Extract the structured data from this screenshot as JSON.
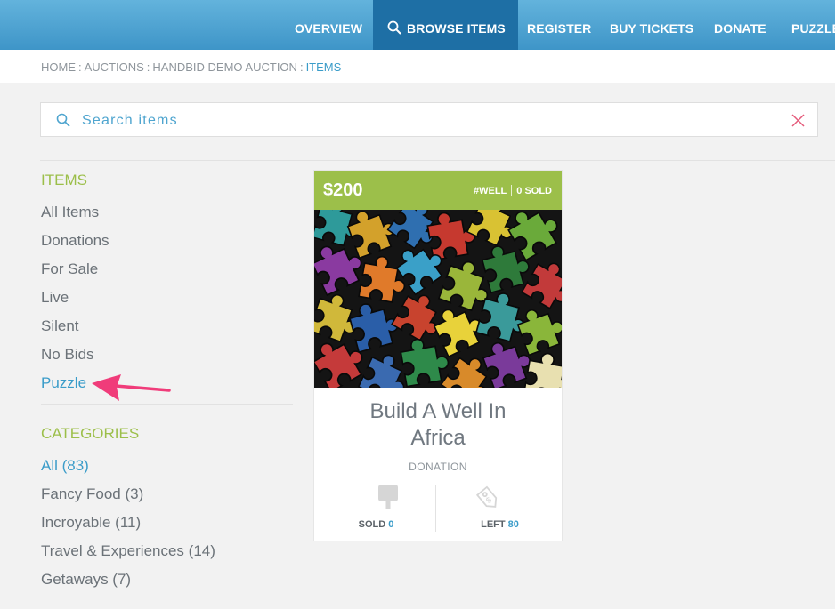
{
  "nav": {
    "items": [
      "OVERVIEW",
      "BROWSE ITEMS",
      "REGISTER",
      "BUY TICKETS",
      "DONATE",
      "PUZZLE"
    ]
  },
  "breadcrumb": {
    "items": [
      "HOME",
      "AUCTIONS",
      "HANDBID DEMO AUCTION",
      "ITEMS"
    ],
    "separator": ":"
  },
  "search": {
    "placeholder": "Search items"
  },
  "sidebar": {
    "items_title": "ITEMS",
    "items": [
      "All Items",
      "Donations",
      "For Sale",
      "Live",
      "Silent",
      "No Bids",
      "Puzzle"
    ],
    "categories_title": "CATEGORIES",
    "categories": [
      "All (83)",
      "Fancy Food (3)",
      "Incroyable (11)",
      "Travel & Experiences (14)",
      "Getaways (7)"
    ]
  },
  "card": {
    "price": "$200",
    "code": "#WELL",
    "sold_badge": "0 SOLD",
    "title_line1": "Build A Well In",
    "title_line2": "Africa",
    "type": "DONATION",
    "sold_label": "SOLD",
    "sold_value": "0",
    "left_label": "LEFT",
    "left_value": "80"
  },
  "colors": {
    "accent_blue": "#3a9cc9",
    "accent_green": "#9cbf4a",
    "nav_active": "#1e6fa5",
    "annotation_pink": "#f03c7a"
  }
}
